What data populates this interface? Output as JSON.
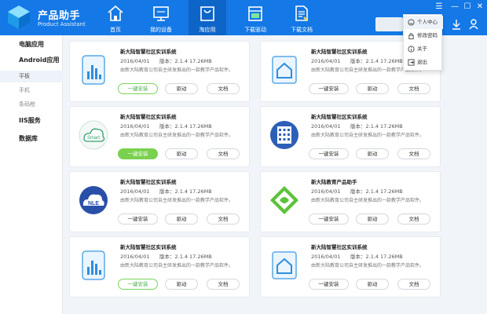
{
  "app": {
    "title": "产品助手",
    "subtitle": "Product Assistant"
  },
  "nav": [
    {
      "label": "首页",
      "icon": "home-icon"
    },
    {
      "label": "我的设备",
      "icon": "monitor-icon"
    },
    {
      "label": "淘应用",
      "icon": "shopping-bag-icon"
    },
    {
      "label": "下载驱动",
      "icon": "driver-download-icon"
    },
    {
      "label": "下载文档",
      "icon": "document-download-icon"
    }
  ],
  "user_menu": {
    "items": [
      {
        "label": "个人中心",
        "icon": "smiley-icon"
      },
      {
        "label": "修改密码",
        "icon": "lock-icon"
      },
      {
        "label": "关于",
        "icon": "info-icon"
      },
      {
        "label": "退出",
        "icon": "exit-icon"
      }
    ]
  },
  "sidebar": {
    "items": [
      {
        "label": "电脑应用",
        "level": "main"
      },
      {
        "label": "Android应用",
        "level": "main"
      },
      {
        "label": "平板",
        "level": "sub"
      },
      {
        "label": "手机",
        "level": "sub"
      },
      {
        "label": "条码枪",
        "level": "sub"
      },
      {
        "label": "IIS服务",
        "level": "main"
      },
      {
        "label": "数据库",
        "level": "main"
      }
    ]
  },
  "buttons": {
    "install": "一键安装",
    "driver": "驱动",
    "doc": "文档"
  },
  "cards": [
    {
      "title": "新大陆智慧社区实训系统",
      "date": "2016/04/01",
      "version": "版本：2.1.4",
      "size": "17.26MB",
      "desc": "由新大陆教育公司自主研发推出的一款教学产品软件。",
      "icon": "bar-chart-phone-icon",
      "install_style": "outline-green"
    },
    {
      "title": "新大陆智慧社区实训系统",
      "date": "2016/04/01",
      "version": "版本：2.1.4",
      "size": "17.26MB",
      "desc": "由新大陆教育公司自主研发推出的一款教学产品软件。",
      "icon": "home-tablet-icon",
      "install_style": "plain"
    },
    {
      "title": "新大陆智慧社区实训系统",
      "date": "2016/04/01",
      "version": "版本：2.1.4",
      "size": "17.26MB",
      "desc": "由新大陆教育公司自主研发推出的一款教学产品软件。",
      "icon": "smart-cloud-icon",
      "install_style": "filled"
    },
    {
      "title": "新大陆智慧社区实训系统",
      "date": "2016/04/01",
      "version": "版本：2.1.4",
      "size": "17.26MB",
      "desc": "由新大陆教育公司自主研发推出的一款教学产品软件。",
      "icon": "building-icon",
      "install_style": "plain"
    },
    {
      "title": "新大陆智慧社区实训系统",
      "date": "2016/04/01",
      "version": "版本：2.1.4",
      "size": "17.26MB",
      "desc": "由新大陆教育公司自主研发推出的一款教学产品软件。",
      "icon": "nle-cloud-icon",
      "install_style": "plain"
    },
    {
      "title": "新大陆教育产品助手",
      "date": "2016/04/01",
      "version": "版本：2.1.4",
      "size": "17.26MB",
      "desc": "由新大陆教育公司自主研发推出的一款教学产品软件。",
      "icon": "green-diamond-icon",
      "install_style": "plain"
    },
    {
      "title": "新大陆智慧社区实训系统",
      "date": "2016/04/01",
      "version": "版本：2.1.4",
      "size": "17.26MB",
      "desc": "由新大陆教育公司自主研发推出的一款教学产品软件。",
      "icon": "bar-chart-phone-icon",
      "install_style": "outline-green"
    },
    {
      "title": "新大陆智慧社区实训系统",
      "date": "2016/04/01",
      "version": "版本：2.1.4",
      "size": "17.26MB",
      "desc": "由新大陆教育公司自主研发推出的一款教学产品软件。",
      "icon": "home-tablet-icon",
      "install_style": "plain"
    }
  ]
}
